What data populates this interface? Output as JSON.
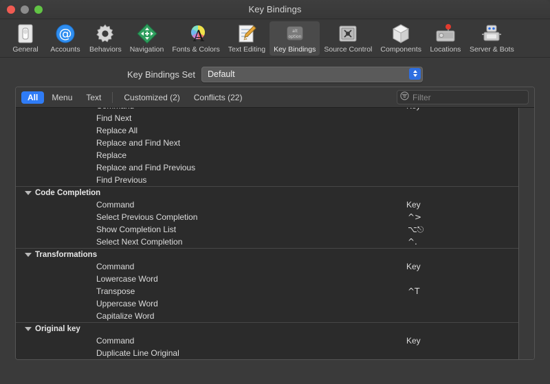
{
  "window": {
    "title": "Key Bindings",
    "traffic_lights": [
      "close-button",
      "minimize-button",
      "zoom-button"
    ]
  },
  "toolbar": {
    "items": [
      {
        "label": "General",
        "icon": "general-switch-icon",
        "selected": false
      },
      {
        "label": "Accounts",
        "icon": "at-sign-icon",
        "selected": false
      },
      {
        "label": "Behaviors",
        "icon": "gear-icon",
        "selected": false
      },
      {
        "label": "Navigation",
        "icon": "move-arrows-icon",
        "selected": false
      },
      {
        "label": "Fonts & Colors",
        "icon": "font-color-wheel-icon",
        "selected": false
      },
      {
        "label": "Text Editing",
        "icon": "document-pencil-icon",
        "selected": false
      },
      {
        "label": "Key Bindings",
        "icon": "option-key-icon",
        "selected": true
      },
      {
        "label": "Source Control",
        "icon": "safe-vault-icon",
        "selected": false
      },
      {
        "label": "Components",
        "icon": "cube-icon",
        "selected": false
      },
      {
        "label": "Locations",
        "icon": "hard-drive-pin-icon",
        "selected": false
      },
      {
        "label": "Server & Bots",
        "icon": "robot-icon",
        "selected": false
      }
    ]
  },
  "settings": {
    "key_bindings_set_label": "Key Bindings Set",
    "key_bindings_set_value": "Default"
  },
  "tabs": [
    {
      "label": "All",
      "active": true
    },
    {
      "label": "Menu",
      "active": false
    },
    {
      "label": "Text",
      "active": false
    },
    {
      "label": "Customized (2)",
      "active": false
    },
    {
      "label": "Conflicts (22)",
      "active": false
    }
  ],
  "filter": {
    "placeholder": "Filter",
    "value": "",
    "icon": "filter-funnel-icon"
  },
  "list": {
    "column_command": "Command",
    "column_key": "Key",
    "groups": [
      {
        "name": null,
        "header": true,
        "rows": [
          {
            "command": "Find Next",
            "key": ""
          },
          {
            "command": "Replace All",
            "key": ""
          },
          {
            "command": "Replace and Find Next",
            "key": ""
          },
          {
            "command": "Replace",
            "key": ""
          },
          {
            "command": "Replace and Find Previous",
            "key": ""
          },
          {
            "command": "Find Previous",
            "key": ""
          }
        ]
      },
      {
        "name": "Code Completion",
        "header": true,
        "rows": [
          {
            "command": "Select Previous Completion",
            "key": "^>",
            "warning": false
          },
          {
            "command": "Show Completion List",
            "key": "⌥⎋",
            "warning": true
          },
          {
            "command": "Select Next Completion",
            "key": "^.",
            "warning": false
          }
        ]
      },
      {
        "name": "Transformations",
        "header": true,
        "rows": [
          {
            "command": "Lowercase Word",
            "key": ""
          },
          {
            "command": "Transpose",
            "key": "^T"
          },
          {
            "command": "Uppercase Word",
            "key": ""
          },
          {
            "command": "Capitalize Word",
            "key": ""
          }
        ]
      },
      {
        "name": "Original key",
        "header": true,
        "rows": [
          {
            "command": "Duplicate Line Original",
            "key": ""
          }
        ]
      }
    ]
  },
  "colors": {
    "window_bg": "#3a3a3a",
    "panel_bg": "#2b2b2b",
    "accent_blue": "#2f7cf6",
    "popup_arrow_blue": "#2f6fe0",
    "warning_orange": "#f0a030",
    "text_primary": "#dcdcdc"
  }
}
